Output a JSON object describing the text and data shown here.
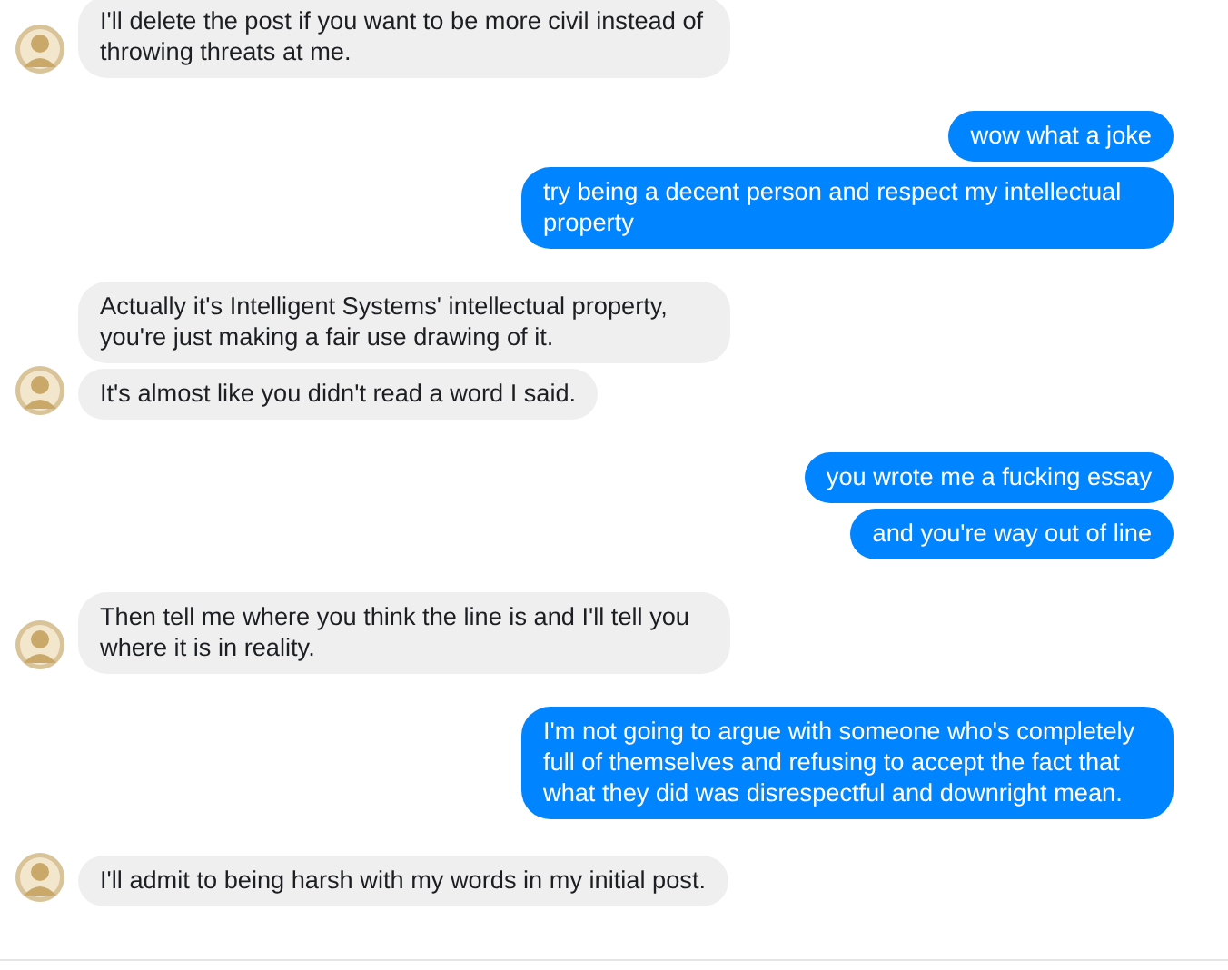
{
  "groups": [
    {
      "kind": "received",
      "messages": [
        "I'll delete the post if you want to be more civil instead of throwing threats at me."
      ]
    },
    {
      "kind": "sent",
      "messages": [
        "wow what a joke",
        "try being a decent person and respect my intellectual property"
      ]
    },
    {
      "kind": "received",
      "messages": [
        "Actually it's Intelligent Systems' intellectual property, you're just making a fair use drawing of it.",
        "It's almost like you didn't read a word I said."
      ]
    },
    {
      "kind": "sent",
      "messages": [
        "you wrote me a fucking essay",
        "and you're way out of line"
      ]
    },
    {
      "kind": "received",
      "messages": [
        "Then tell me where you think the line is and I'll tell you where it is in reality."
      ]
    },
    {
      "kind": "sent",
      "messages": [
        "I'm not going to argue with someone who's completely full of themselves and refusing to accept the fact that what they did was disrespectful and downright mean."
      ]
    },
    {
      "kind": "received",
      "messages": [
        "I'll admit to being harsh with my words in my initial post."
      ]
    }
  ]
}
